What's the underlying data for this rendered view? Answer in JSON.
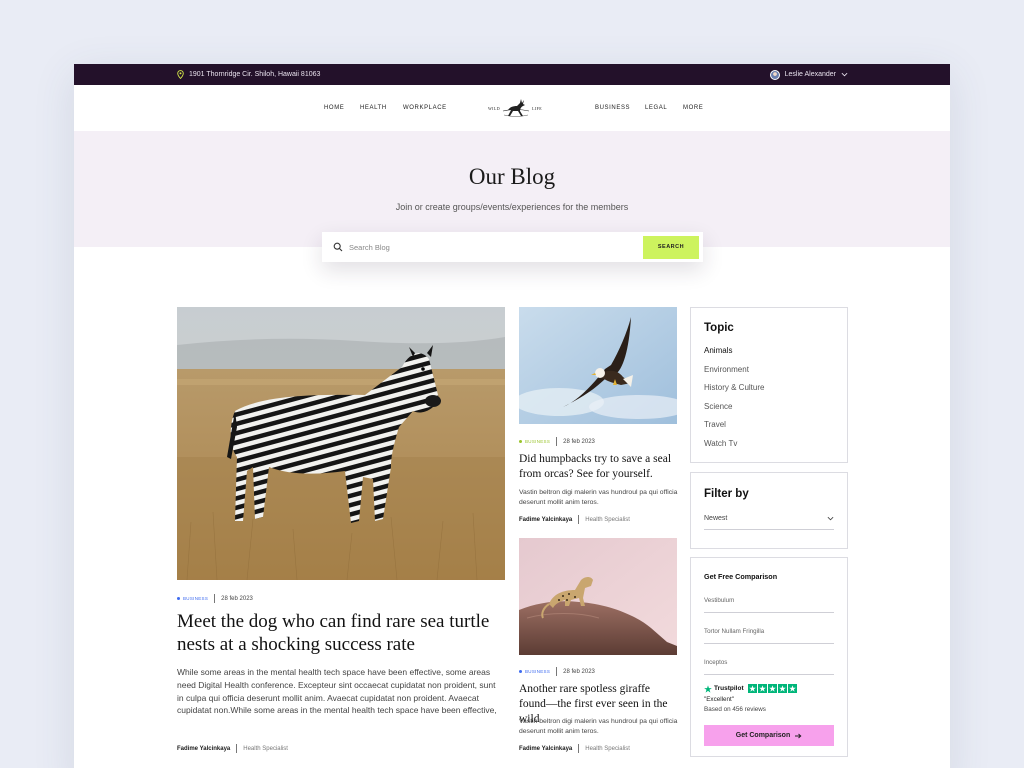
{
  "topbar": {
    "address": "1901 Thornridge Cir. Shiloh, Hawaii 81063",
    "user_name": "Leslie Alexander"
  },
  "nav": {
    "left_items": [
      "HOME",
      "HEALTH",
      "WORKPLACE"
    ],
    "right_items": [
      "BUSINESS",
      "LEGAL",
      "MORE"
    ],
    "logo_left": "WILD",
    "logo_right": "LIFE"
  },
  "hero": {
    "title": "Our Blog",
    "subtitle": "Join or create groups/events/experiences for the members"
  },
  "search": {
    "placeholder": "Search Blog",
    "button": "SEARCH"
  },
  "posts": [
    {
      "tag": "BUSINESS",
      "tag_color": "#3f6cf0",
      "date": "28 feb 2023",
      "title": "Meet the dog who can find rare sea turtle nests at a shocking success rate",
      "excerpt": "While some areas in the mental health tech space have been effective, some areas need Digital Health conference. Excepteur sint occaecat cupidatat non proident, sunt in culpa qui officia deserunt mollit anim. Avaecat cupidatat non proident. Avaecat cupidatat non.While some areas in the mental health tech space have been effective,",
      "author": "Fadime Yalcinkaya",
      "role": "Health Specialist",
      "image": "zebra"
    },
    {
      "tag": "BUSINESS",
      "tag_color": "#9ac42c",
      "date": "28 feb 2023",
      "title": "Did humpbacks try to save a seal from orcas? See for yourself.",
      "excerpt": "Vastin beltron digi malerin vas hundroul pa qui officia deserunt mollit anim teros.",
      "author": "Fadime Yalcinkaya",
      "role": "Health Specialist",
      "image": "eagle"
    },
    {
      "tag": "BUSINESS",
      "tag_color": "#3f6cf0",
      "date": "28 feb 2023",
      "title": "Another rare spotless giraffe found—the first ever seen in the wild",
      "excerpt": "Vastin beltron digi malerin vas hundroul pa qui officia deserunt mollit anim teros.",
      "author": "Fadime Yalcinkaya",
      "role": "Health Specialist",
      "image": "leopard"
    }
  ],
  "sidebar": {
    "topic": {
      "heading": "Topic",
      "items": [
        "Animals",
        "Environment",
        "History & Culture",
        "Science",
        "Travel",
        "Watch Tv"
      ],
      "active_index": 0
    },
    "filter": {
      "heading": "Filter by",
      "selected": "Newest"
    },
    "comparison": {
      "heading": "Get Free Comparison",
      "fields": [
        "Vestibulum",
        "Tortor Nullam Fringilla",
        "Inceptos"
      ],
      "trustpilot_label": "Trustpilot",
      "rating_text": "\"Excellent\"",
      "reviews": "Based on 456 reviews",
      "stars": 5,
      "button": "Get Comparison"
    }
  },
  "colors": {
    "topbar": "#23112a",
    "hero_bg": "#f4eff6",
    "search_button": "#cdf35e",
    "cta_button": "#f7a1ec",
    "trustpilot_green": "#00b67a"
  }
}
